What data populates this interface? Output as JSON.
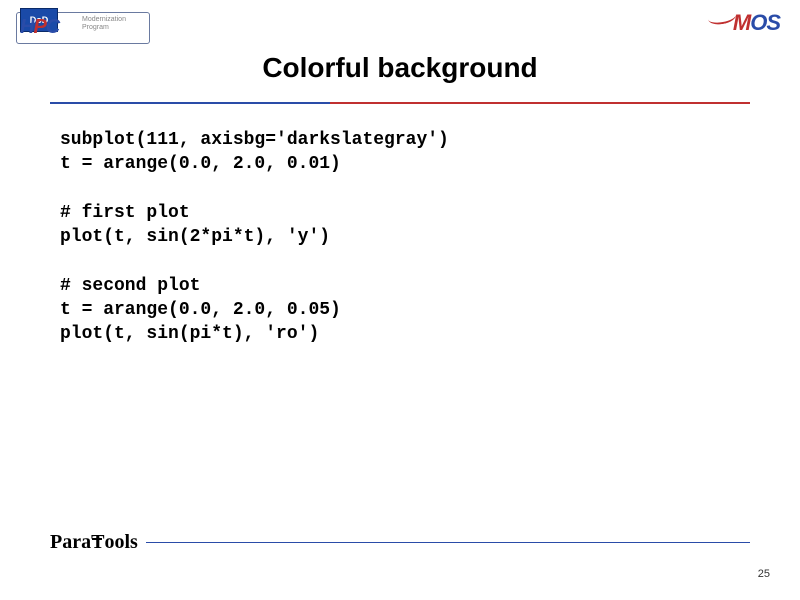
{
  "header": {
    "leftLogo": {
      "badge": "DoD",
      "main_prefix": "H",
      "main_red": "P",
      "main_suffix": "C",
      "sub": "Modernization\nProgram"
    },
    "rightLogo": {
      "m": "M",
      "os": "OS"
    }
  },
  "title": "Colorful background",
  "code": "subplot(111, axisbg='darkslategray')\nt = arange(0.0, 2.0, 0.01)\n\n# first plot\nplot(t, sin(2*pi*t), 'y')\n\n# second plot\nt = arange(0.0, 2.0, 0.05)\nplot(t, sin(pi*t), 'ro')",
  "footer": {
    "logo": "ParaTools"
  },
  "pageNumber": "25"
}
